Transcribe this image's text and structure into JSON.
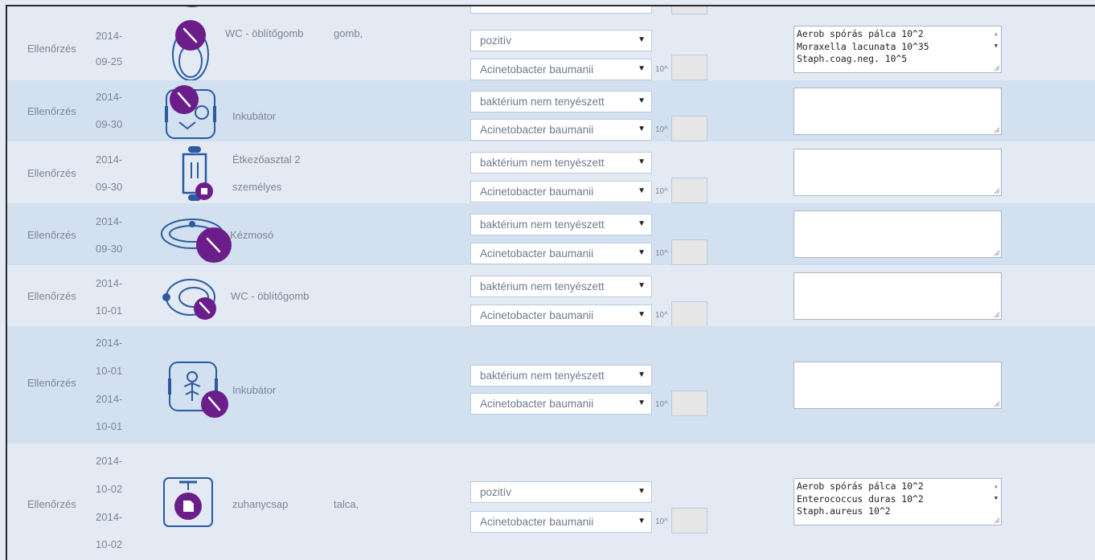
{
  "options": {
    "result_positive": "pozitív",
    "result_not_cultured": "baktérium nem tenyészett",
    "bacterium": "Acinetobacter baumanii",
    "exponent": "10^"
  },
  "rows": [
    {
      "type": "Ellenőrzés",
      "dates": [
        "2014-",
        "09-25"
      ],
      "icon": "toilet-flush-button-icon",
      "place": "WC - öblítőgomb",
      "detail": "gomb,",
      "result": "pozitív",
      "bacterium": "Acinetobacter baumanii",
      "notes": [
        "Aerob spórás pálca 10^2",
        "Moraxella lacunata 10^35",
        "Staph.coag.neg. 10^5"
      ]
    },
    {
      "type": "Ellenőrzés",
      "dates": [
        "2014-",
        "09-30"
      ],
      "icon": "incubator-icon",
      "place": "Inkubátor",
      "detail": "",
      "result": "baktérium nem tenyészett",
      "bacterium": "Acinetobacter baumanii",
      "notes": []
    },
    {
      "type": "Ellenőrzés",
      "dates": [
        "2014-",
        "09-30"
      ],
      "icon": "dining-table-icon",
      "place": "Étkezőasztal 2",
      "place2": "személyes",
      "detail": "",
      "result": "baktérium nem tenyészett",
      "bacterium": "Acinetobacter baumanii",
      "notes": []
    },
    {
      "type": "Ellenőrzés",
      "dates": [
        "2014-",
        "09-30"
      ],
      "icon": "sink-icon",
      "place": "Kézmosó",
      "detail": "",
      "result": "baktérium nem tenyészett",
      "bacterium": "Acinetobacter baumanii",
      "notes": []
    },
    {
      "type": "Ellenőrzés",
      "dates": [
        "2014-",
        "10-01"
      ],
      "icon": "toilet-flush-button-icon",
      "place": "WC - öblítőgomb",
      "detail": "",
      "result": "baktérium nem tenyészett",
      "bacterium": "Acinetobacter baumanii",
      "notes": []
    },
    {
      "type": "Ellenőrzés",
      "dates": [
        "2014-",
        "10-01",
        "2014-",
        "10-01"
      ],
      "icon": "baby-incubator-icon",
      "place": "Inkubátor",
      "detail": "",
      "result": "baktérium nem tenyészett",
      "bacterium": "Acinetobacter baumanii",
      "notes": []
    },
    {
      "type": "Ellenőrzés",
      "dates": [
        "2014-",
        "10-02",
        "2014-",
        "10-02"
      ],
      "icon": "shower-tap-icon",
      "place": "zuhanycsap",
      "detail": "talca,",
      "result": "pozitív",
      "bacterium": "Acinetobacter baumanii",
      "notes": [
        "Aerob spórás pálca 10^2",
        "Enterococcus duras 10^2",
        "Staph.aureus 10^2"
      ]
    }
  ],
  "colors": {
    "accent_purple": "#6b1e8a",
    "icon_blue": "#2a5aa0",
    "row_light": "#e3eaf3",
    "row_dark": "#d3e0ef",
    "row_border": "#7fa3c9"
  }
}
